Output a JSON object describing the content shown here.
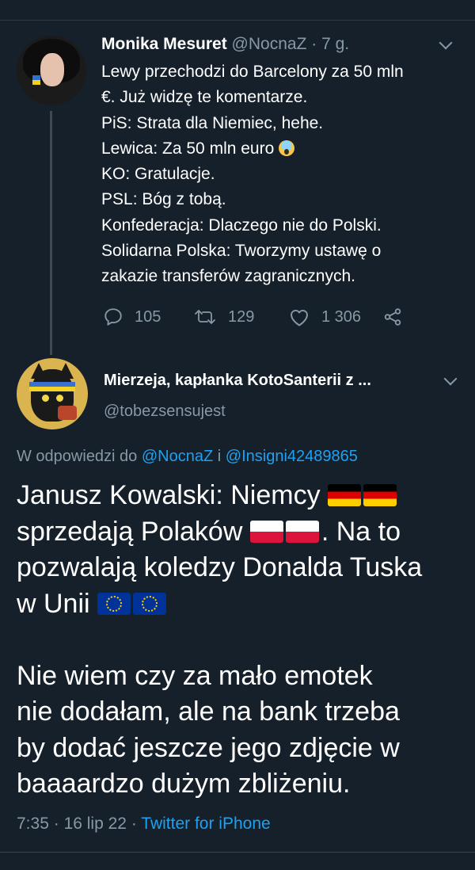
{
  "tweet1": {
    "name": "Monika Mesuret",
    "handle": "@NocnaZ",
    "separator": "·",
    "time": "7 g.",
    "lines": [
      "Lewy przechodzi do Barcelony za 50 mln",
      "€. Już widzę te komentarze.",
      "PiS: Strata dla Niemiec, hehe.",
      "Lewica: Za 50 mln euro",
      "KO: Gratulacje.",
      "PSL: Bóg z tobą.",
      "Konfederacja: Dlaczego nie do Polski.",
      "Solidarna Polska: Tworzymy ustawę o",
      "zakazie transferów zagranicznych."
    ],
    "replies": "105",
    "retweets": "129",
    "likes": "1 306"
  },
  "tweet2": {
    "name": "Mierzeja, kapłanka KotoSanterii z ...",
    "handle": "@tobezsensujest",
    "reply_prefix": "W odpowiedzi do",
    "reply_mention1": "@NocnaZ",
    "reply_joiner": "i",
    "reply_mention2": "@Insigni42489865",
    "body": {
      "line1": "Janusz Kowalski: Niemcy",
      "line2_a": "sprzedają Polaków",
      "line2_b": ". Na to",
      "line3": "pozwalają koledzy Donalda Tuska",
      "line4": "w Unii",
      "line5": "Nie wiem czy za mało emotek",
      "line6": "nie dodałam, ale na bank trzeba",
      "line7": "by dodać jeszcze jego zdjęcie w",
      "line8": "baaaardzo dużym zbliżeniu."
    },
    "time": "7:35",
    "date": "16 lip 22",
    "source": "Twitter for iPhone",
    "separator": "·"
  },
  "colors": {
    "background": "#15202b",
    "secondary_text": "#8899a6",
    "link": "#1da1f2"
  }
}
